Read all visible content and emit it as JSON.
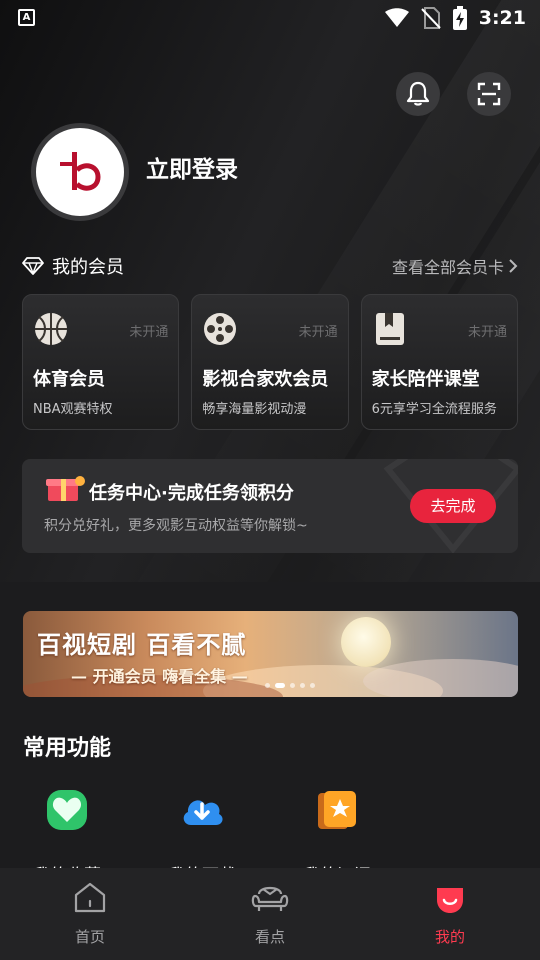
{
  "status_bar": {
    "left_badge": "A",
    "time": "3:21",
    "icons": [
      "wifi-icon",
      "no-sim-icon",
      "battery-charging-icon"
    ]
  },
  "header": {
    "notification_icon": "bell-icon",
    "scan_icon": "scan-icon"
  },
  "profile": {
    "avatar_glyph": "b",
    "login_label": "立即登录"
  },
  "membership": {
    "title": "我的会员",
    "view_all": "查看全部会员卡",
    "cards": [
      {
        "icon": "basketball-icon",
        "status": "未开通",
        "name": "体育会员",
        "desc": "NBA观赛特权"
      },
      {
        "icon": "film-reel-icon",
        "status": "未开通",
        "name": "影视合家欢会员",
        "desc": "畅享海量影视动漫"
      },
      {
        "icon": "book-icon",
        "status": "未开通",
        "name": "家长陪伴课堂",
        "desc": "6元享学习全流程服务"
      }
    ]
  },
  "task": {
    "title": "任务中心·完成任务领积分",
    "desc": "积分兑好礼，更多观影互动权益等你解锁~",
    "button": "去完成",
    "icon": "gift-icon"
  },
  "banner": {
    "title": "百视短剧 百看不腻",
    "subtitle": "— 开通会员 嗨看全集 —"
  },
  "functions": {
    "title": "常用功能",
    "items": [
      {
        "icon": "heart-icon",
        "label": "我的收藏"
      },
      {
        "icon": "cloud-download-icon",
        "label": "我的下载"
      },
      {
        "icon": "star-subscribe-icon",
        "label": "我的订阅"
      }
    ]
  },
  "tabbar": {
    "tabs": [
      {
        "icon": "home-icon",
        "label": "首页"
      },
      {
        "icon": "sofa-icon",
        "label": "看点"
      },
      {
        "icon": "mine-icon",
        "label": "我的"
      }
    ],
    "active_color": "#ff3b50"
  }
}
